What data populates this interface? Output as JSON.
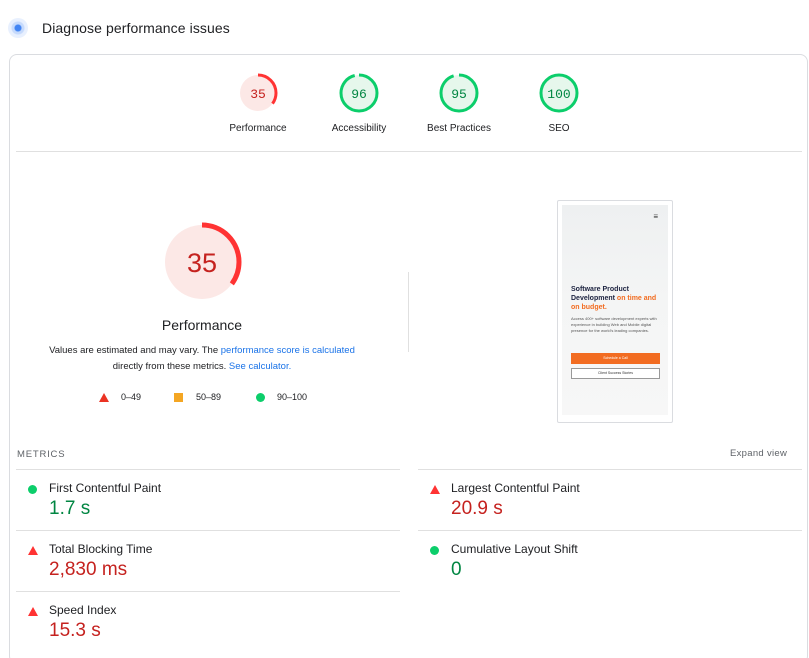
{
  "header": {
    "title": "Diagnose performance issues",
    "icon": "lighthouse-icon"
  },
  "categories": [
    {
      "score": "35",
      "label": "Performance",
      "value": 35,
      "status": "poor"
    },
    {
      "score": "96",
      "label": "Accessibility",
      "value": 96,
      "status": "good"
    },
    {
      "score": "95",
      "label": "Best Practices",
      "value": 95,
      "status": "good"
    },
    {
      "score": "100",
      "label": "SEO",
      "value": 100,
      "status": "good"
    }
  ],
  "main": {
    "score": "35",
    "value": 35,
    "title": "Performance",
    "note_prefix": "Values are estimated and may vary. The ",
    "note_link1": "performance score is calculated",
    "note_mid": "directly from these metrics. ",
    "note_link2": "See calculator."
  },
  "legend": {
    "poor": "0–49",
    "average": "50–89",
    "good": "90–100"
  },
  "screenshot": {
    "heading_dark": "Software Product Development",
    "heading_orange": "on time and on budget.",
    "body": "Access 400+ software development experts with experience in building Web and Mobile digital presence for the world's leading companies.",
    "button_primary": "Schedule a Call",
    "button_secondary": "Client Success Stories",
    "menu_icon": "hamburger-menu-icon"
  },
  "metrics": {
    "label": "METRICS",
    "expand": "Expand view",
    "items": [
      {
        "name": "First Contentful Paint",
        "value": "1.7 s",
        "status": "good"
      },
      {
        "name": "Largest Contentful Paint",
        "value": "20.9 s",
        "status": "poor"
      },
      {
        "name": "Total Blocking Time",
        "value": "2,830 ms",
        "status": "poor"
      },
      {
        "name": "Cumulative Layout Shift",
        "value": "0",
        "status": "good"
      },
      {
        "name": "Speed Index",
        "value": "15.3 s",
        "status": "poor"
      }
    ]
  },
  "colors": {
    "poor": "#ff3333",
    "poor_bg": "#fce8e6",
    "poor_text": "#c5221f",
    "good": "#0cce6b",
    "good_bg": "#e6f7ec",
    "good_text": "#018642",
    "average": "#f4a623",
    "link": "#1a73e8"
  }
}
